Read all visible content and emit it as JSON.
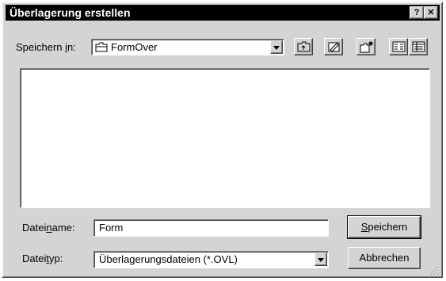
{
  "window": {
    "title": "Überlagerung erstellen",
    "help_button": "?",
    "close_button": "✕"
  },
  "lookin": {
    "label_before": "Speichern ",
    "label_hotkey": "i",
    "label_after": "n:",
    "value": "FormOver"
  },
  "toolbar": {
    "icons": [
      "folder-up-icon",
      "desktop-icon",
      "new-folder-icon",
      "list-view-icon",
      "details-view-icon"
    ]
  },
  "filename": {
    "label_before": "Datei",
    "label_hotkey": "n",
    "label_after": "ame:",
    "value": "Form"
  },
  "filetype": {
    "label_before": "Datei",
    "label_hotkey": "t",
    "label_after": "yp:",
    "value": "Überlagerungsdateien (*.OVL)"
  },
  "buttons": {
    "save_hotkey": "S",
    "save_rest": "peichern",
    "cancel": "Abbrechen"
  }
}
